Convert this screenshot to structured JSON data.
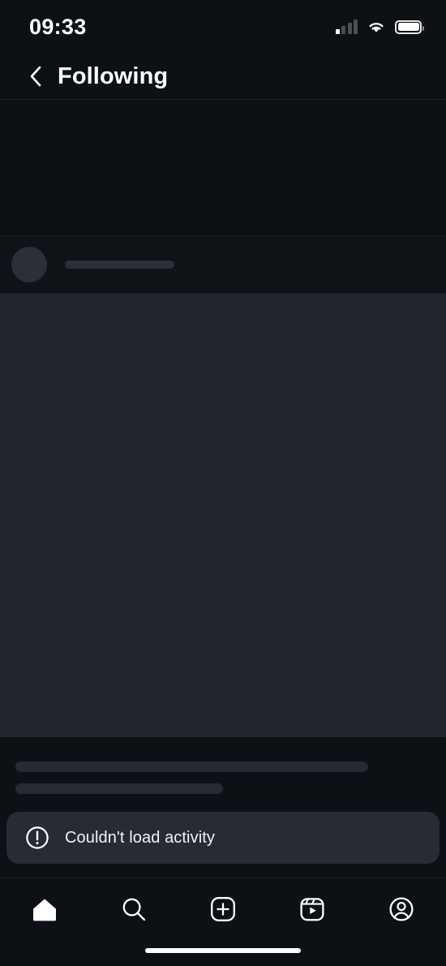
{
  "status_bar": {
    "time": "09:33",
    "signal_icon": "cellular-signal-icon",
    "signal_bars_total": 4,
    "signal_bars_active": 1,
    "wifi_icon": "wifi-icon",
    "battery_icon": "battery-icon",
    "battery_level_percent": 85
  },
  "header": {
    "back_icon": "chevron-left-icon",
    "title": "Following"
  },
  "content": {
    "state": "loading-skeleton",
    "skeleton": {
      "avatar_placeholder": "skeleton-avatar",
      "header_line_placeholder": "skeleton-line",
      "media_block_placeholder": "skeleton-media-block",
      "text_line_long_placeholder": "skeleton-line-long",
      "text_line_short_placeholder": "skeleton-line-short"
    }
  },
  "toast": {
    "icon": "exclamation-circle-icon",
    "message": "Couldn't load activity"
  },
  "tab_bar": {
    "items": [
      {
        "name": "home",
        "icon": "home-icon",
        "active": true
      },
      {
        "name": "search",
        "icon": "search-icon",
        "active": false
      },
      {
        "name": "create",
        "icon": "plus-square-icon",
        "active": false
      },
      {
        "name": "reels",
        "icon": "reels-icon",
        "active": false
      },
      {
        "name": "profile",
        "icon": "profile-circle-icon",
        "active": false
      }
    ],
    "home_indicator": "home-indicator"
  },
  "colors": {
    "background": "#0d1014",
    "skeleton_block": "#21242d",
    "skeleton_line": "#2b2f38",
    "toast_background": "#272b34",
    "text_primary": "#ffffff",
    "divider": "#1b1f25"
  }
}
